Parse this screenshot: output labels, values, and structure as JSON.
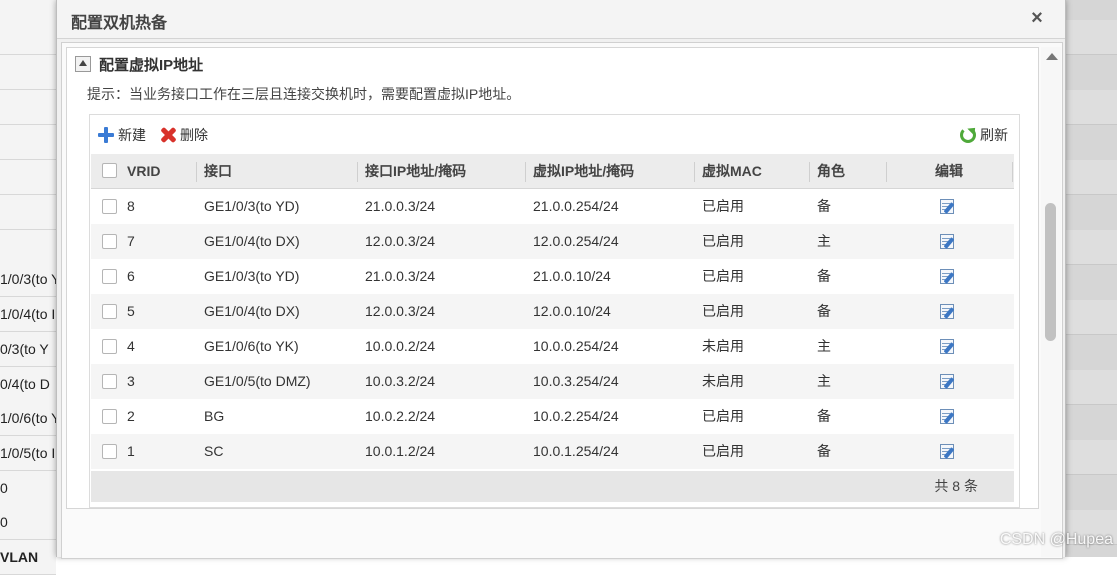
{
  "background": {
    "left_rows": [
      "1/0/3(to Y",
      "1/0/4(to I",
      "0/3(to Y",
      "0/4(to D",
      "1/0/6(to Y",
      "1/0/5(to I",
      "0",
      "0",
      "VLAN"
    ]
  },
  "dialog": {
    "title": "配置双机热备",
    "close_label": "×",
    "section_title": "配置虚拟IP地址",
    "hint": "提示：当业务接口工作在三层且连接交换机时，需要配置虚拟IP地址。",
    "toolbar": {
      "new_label": "新建",
      "delete_label": "删除",
      "refresh_label": "刷新"
    },
    "columns": [
      "VRID",
      "接口",
      "接口IP地址/掩码",
      "虚拟IP地址/掩码",
      "虚拟MAC",
      "角色",
      "编辑"
    ],
    "rows": [
      {
        "vrid": "8",
        "iface": "GE1/0/3(to YD)",
        "ip": "21.0.0.3/24",
        "vip": "21.0.0.254/24",
        "mac": "已启用",
        "role": "备"
      },
      {
        "vrid": "7",
        "iface": "GE1/0/4(to DX)",
        "ip": "12.0.0.3/24",
        "vip": "12.0.0.254/24",
        "mac": "已启用",
        "role": "主"
      },
      {
        "vrid": "6",
        "iface": "GE1/0/3(to YD)",
        "ip": "21.0.0.3/24",
        "vip": "21.0.0.10/24",
        "mac": "已启用",
        "role": "备"
      },
      {
        "vrid": "5",
        "iface": "GE1/0/4(to DX)",
        "ip": "12.0.0.3/24",
        "vip": "12.0.0.10/24",
        "mac": "已启用",
        "role": "备"
      },
      {
        "vrid": "4",
        "iface": "GE1/0/6(to YK)",
        "ip": "10.0.0.2/24",
        "vip": "10.0.0.254/24",
        "mac": "未启用",
        "role": "主"
      },
      {
        "vrid": "3",
        "iface": "GE1/0/5(to DMZ)",
        "ip": "10.0.3.2/24",
        "vip": "10.0.3.254/24",
        "mac": "未启用",
        "role": "主"
      },
      {
        "vrid": "2",
        "iface": "BG",
        "ip": "10.0.2.2/24",
        "vip": "10.0.2.254/24",
        "mac": "已启用",
        "role": "备"
      },
      {
        "vrid": "1",
        "iface": "SC",
        "ip": "10.0.1.2/24",
        "vip": "10.0.1.254/24",
        "mac": "已启用",
        "role": "备"
      }
    ],
    "total": "共 8 条"
  },
  "icons": {
    "collapse": "collapse-up-icon",
    "new": "plus-icon",
    "delete": "delete-x-icon",
    "refresh": "refresh-icon",
    "edit": "edit-icon"
  },
  "watermark": "CSDN @Hupea"
}
